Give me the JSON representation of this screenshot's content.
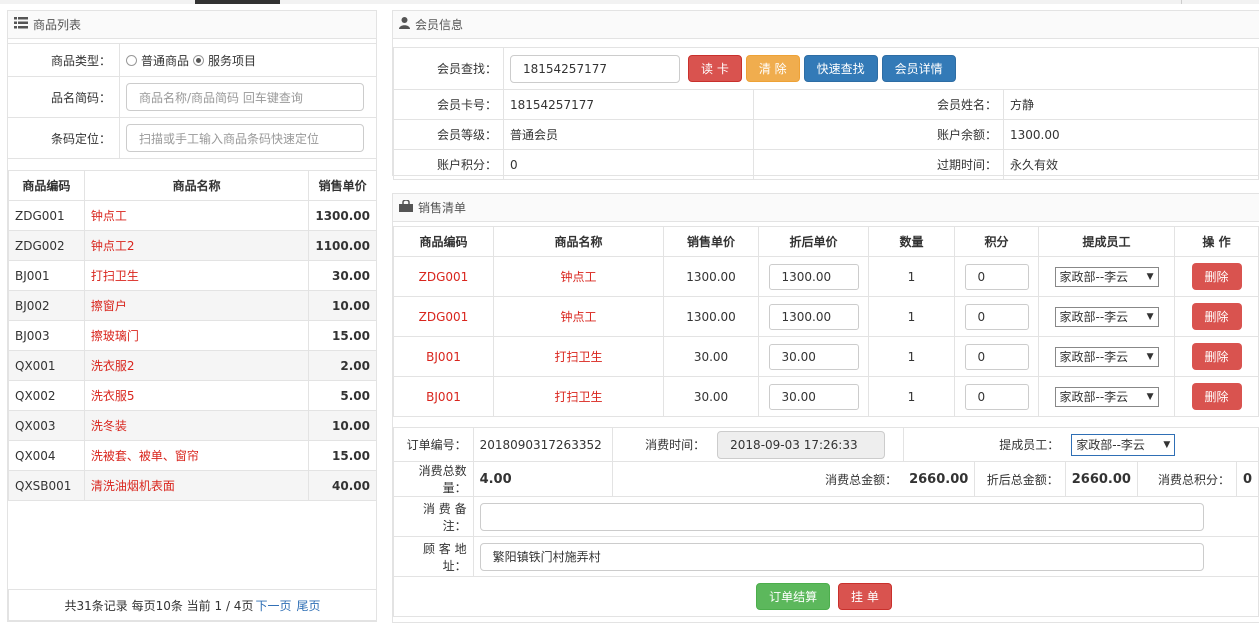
{
  "product_list": {
    "title": "商品列表",
    "type_label": "商品类型：",
    "type_options": [
      "普通商品",
      "服务项目"
    ],
    "name_label": "品名简码：",
    "name_placeholder": "商品名称/商品简码 回车键查询",
    "barcode_label": "条码定位：",
    "barcode_placeholder": "扫描或手工输入商品条码快速定位",
    "columns": [
      "商品编码",
      "商品名称",
      "销售单价"
    ],
    "rows": [
      {
        "code": "ZDG001",
        "name": "钟点工",
        "price": "1300.00"
      },
      {
        "code": "ZDG002",
        "name": "钟点工2",
        "price": "1100.00"
      },
      {
        "code": "BJ001",
        "name": "打扫卫生",
        "price": "30.00"
      },
      {
        "code": "BJ002",
        "name": "擦窗户",
        "price": "10.00"
      },
      {
        "code": "BJ003",
        "name": "擦玻璃门",
        "price": "15.00"
      },
      {
        "code": "QX001",
        "name": "洗衣服2",
        "price": "2.00"
      },
      {
        "code": "QX002",
        "name": "洗衣服5",
        "price": "5.00"
      },
      {
        "code": "QX003",
        "name": "洗冬装",
        "price": "10.00"
      },
      {
        "code": "QX004",
        "name": "洗被套、被单、窗帘",
        "price": "15.00"
      },
      {
        "code": "QXSB001",
        "name": "清洗油烟机表面",
        "price": "40.00"
      }
    ],
    "pager": {
      "text": "共31条记录 每页10条 当前 1 / 4页",
      "next": "下一页",
      "last": "尾页"
    }
  },
  "member": {
    "title": "会员信息",
    "search_label": "会员查找：",
    "search_value": "18154257177",
    "btn_read": "读 卡",
    "btn_clear": "清 除",
    "btn_quick": "快速查找",
    "btn_detail": "会员详情",
    "card_label": "会员卡号：",
    "card_value": "18154257177",
    "name_label": "会员姓名：",
    "name_value": "方静",
    "level_label": "会员等级：",
    "level_value": "普通会员",
    "balance_label": "账户余额：",
    "balance_value": "1300.00",
    "points_label": "账户积分：",
    "points_value": "0",
    "expire_label": "过期时间：",
    "expire_value": "永久有效"
  },
  "sales": {
    "title": "销售清单",
    "columns": [
      "商品编码",
      "商品名称",
      "销售单价",
      "折后单价",
      "数量",
      "积分",
      "提成员工",
      "操 作"
    ],
    "rows": [
      {
        "code": "ZDG001",
        "name": "钟点工",
        "price": "1300.00",
        "disc": "1300.00",
        "qty": "1",
        "points": "0",
        "staff": "家政部--李云",
        "op": "删除"
      },
      {
        "code": "ZDG001",
        "name": "钟点工",
        "price": "1300.00",
        "disc": "1300.00",
        "qty": "1",
        "points": "0",
        "staff": "家政部--李云",
        "op": "删除"
      },
      {
        "code": "BJ001",
        "name": "打扫卫生",
        "price": "30.00",
        "disc": "30.00",
        "qty": "1",
        "points": "0",
        "staff": "家政部--李云",
        "op": "删除"
      },
      {
        "code": "BJ001",
        "name": "打扫卫生",
        "price": "30.00",
        "disc": "30.00",
        "qty": "1",
        "points": "0",
        "staff": "家政部--李云",
        "op": "删除"
      }
    ]
  },
  "order": {
    "no_label": "订单编号：",
    "no_value": "2018090317263352",
    "time_label": "消费时间：",
    "time_value": "2018-09-03 17:26:33",
    "staff_label": "提成员工：",
    "staff_value": "家政部--李云",
    "qty_label": "消费总数量：",
    "qty_value": "4.00",
    "amount_label": "消费总金额：",
    "amount_value": "2660.00",
    "disc_label": "折后总金额：",
    "disc_value": "2660.00",
    "points_label": "消费总积分：",
    "points_value": "0",
    "remark_label": "消 费 备 注：",
    "remark_value": "",
    "address_label": "顾 客 地 址：",
    "address_value": "繁阳镇铁门村施弄村",
    "btn_settle": "订单结算",
    "btn_hold": "挂 单"
  }
}
